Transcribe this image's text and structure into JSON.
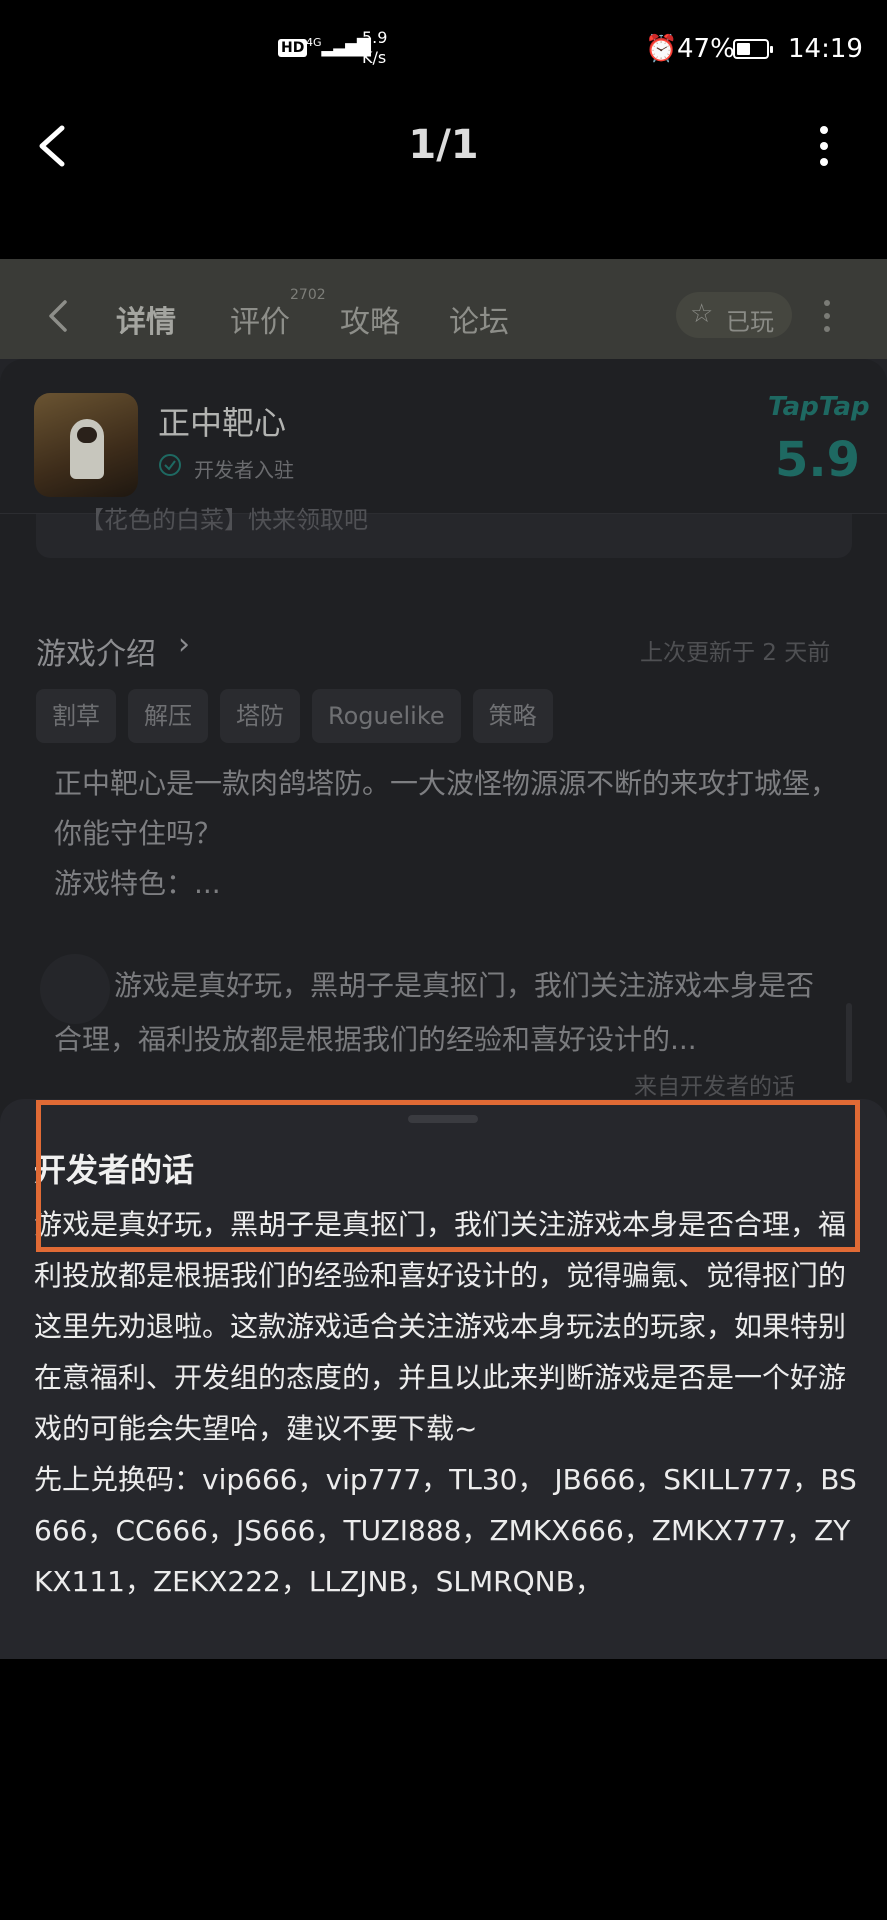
{
  "status_bar": {
    "hd": "HD",
    "signal": "4G",
    "speed_value": "5.9",
    "speed_unit": "K/s",
    "battery_pct": "47%",
    "battery_level": 0.47,
    "time": "14:19"
  },
  "viewer": {
    "counter": "1/1",
    "icons": [
      "back-icon",
      "more-vertical-icon"
    ]
  },
  "app": {
    "nav": {
      "tabs": [
        {
          "label": "详情",
          "active": true
        },
        {
          "label": "评价",
          "badge": "2702"
        },
        {
          "label": "攻略"
        },
        {
          "label": "论坛"
        }
      ],
      "played_label": "已玩"
    },
    "game": {
      "name": "正中靶心",
      "developer_status": "开发者入驻",
      "brand": "TapTap",
      "score": "5.9",
      "banner_partial": "【花色的白菜】快来领取吧"
    },
    "intro": {
      "title": "游戏介绍",
      "updated": "上次更新于 2 天前",
      "tags": [
        "割草",
        "解压",
        "塔防",
        "Roguelike",
        "策略"
      ],
      "description": "正中靶心是一款肉鸽塔防。一大波怪物源源不断的来攻打城堡，你能守住吗？\n游戏特色：..."
    },
    "developer_preview": {
      "text": "游戏是真好玩，黑胡子是真抠门，我们关注游戏本身是否合理，福利投放都是根据我们的经验和喜好设计的...",
      "source": "来自开发者的话"
    },
    "sheet": {
      "title": "开发者的话",
      "body": "游戏是真好玩，黑胡子是真抠门，我们关注游戏本身是否合理，福利投放都是根据我们的经验和喜好设计的，觉得骗氪、觉得抠门的这里先劝退啦。这款游戏适合关注游戏本身玩法的玩家，如果特别在意福利、开发组的态度的，并且以此来判断游戏是否是一个好游戏的可能会失望哈，建议不要下载~\n先上兑换码：vip666，vip777，TL30， JB666，SKILL777，BS666，CC666，JS666，TUZI888，ZMKX666，ZMKX777，ZYKX111，ZEKX222，LLZJNB，SLMRQNB，"
    },
    "accent_colors": {
      "brand": "#1e6962",
      "highlight_box": "#e06a35"
    }
  }
}
